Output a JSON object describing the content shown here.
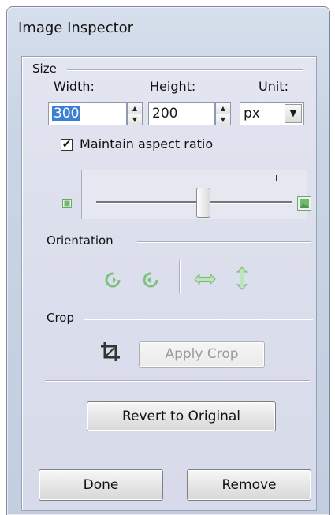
{
  "window": {
    "title": "Image Inspector"
  },
  "size": {
    "section_label": "Size",
    "width_label": "Width:",
    "height_label": "Height:",
    "unit_label": "Unit:",
    "width_value": "300",
    "height_value": "200",
    "unit_value": "px",
    "maintain_aspect_label": "Maintain aspect ratio",
    "maintain_aspect_checked": true,
    "checkmark": "✔",
    "scale_slider_fraction": 0.55
  },
  "orientation": {
    "section_label": "Orientation",
    "icons": [
      "rotate-counterclockwise-icon",
      "rotate-clockwise-icon",
      "flip-horizontal-icon",
      "flip-vertical-icon"
    ]
  },
  "crop": {
    "section_label": "Crop",
    "apply_label": "Apply Crop",
    "icon": "crop-icon"
  },
  "actions": {
    "revert_label": "Revert to Original",
    "done_label": "Done",
    "remove_label": "Remove"
  },
  "colors": {
    "icon_green": "#6fba6f",
    "selection_blue": "#3d7ed6",
    "panel_bg": "#dcdfec"
  }
}
